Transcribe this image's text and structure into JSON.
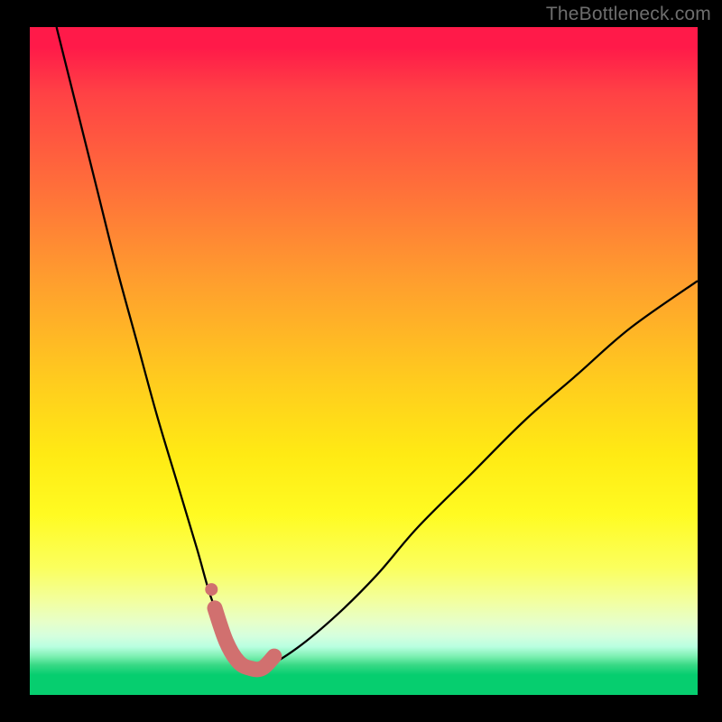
{
  "watermark": "TheBottleneck.com",
  "colors": {
    "background": "#000000",
    "gradient_top": "#ff1a49",
    "gradient_mid": "#ffe017",
    "gradient_bottom": "#06ce6f",
    "curve": "#000000",
    "highlight": "#d1706f"
  },
  "chart_data": {
    "type": "line",
    "title": "",
    "xlabel": "",
    "ylabel": "",
    "xlim": [
      0,
      100
    ],
    "ylim": [
      0,
      100
    ],
    "grid": false,
    "legend": false,
    "series": [
      {
        "name": "bottleneck-curve",
        "x": [
          4,
          7,
          10,
          13,
          16,
          19,
          22,
          25,
          27,
          29,
          31,
          33,
          35,
          40,
          46,
          52,
          58,
          66,
          74,
          82,
          90,
          100
        ],
        "y": [
          100,
          88,
          76,
          64,
          53,
          42,
          32,
          22,
          15,
          10,
          6,
          4,
          4,
          7,
          12,
          18,
          25,
          33,
          41,
          48,
          55,
          62
        ]
      }
    ],
    "highlight_region": {
      "name": "optimal-valley",
      "x": [
        27.7,
        29.4,
        31.2,
        33.0,
        34.8,
        36.6
      ],
      "y": [
        13.0,
        8.0,
        5.0,
        4.0,
        4.0,
        5.8
      ]
    },
    "marker_dot": {
      "x": 27.2,
      "y": 15.8
    }
  }
}
